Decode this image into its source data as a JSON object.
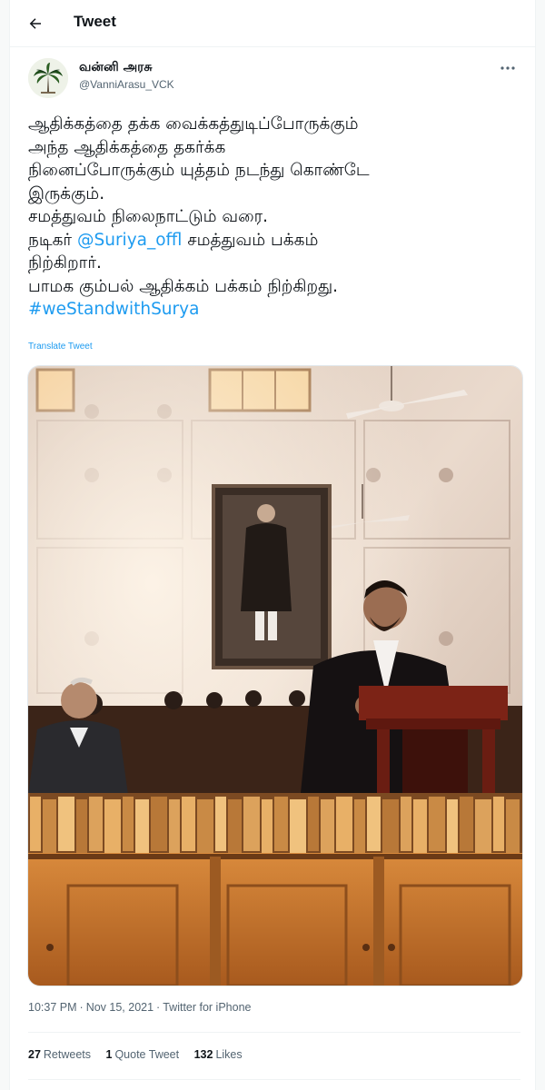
{
  "header": {
    "title": "Tweet",
    "back_icon": "arrow-left-icon"
  },
  "author": {
    "display_name": "வன்னி அரசு",
    "handle": "@VanniArasu_VCK",
    "avatar_icon": "palm-tree-avatar"
  },
  "tweet": {
    "line1": "ஆதிக்கத்தை தக்க வைக்கத்துடிப்போருக்கும்",
    "line2": "அந்த ஆதிக்கத்தை தகர்க்க",
    "line3": "நினைப்போருக்கும் யுத்தம் நடந்து கொண்டே",
    "line4": "இருக்கும்.",
    "line5": "சமத்துவம் நிலைநாட்டும் வரை.",
    "line6_pre": "நடிகர் ",
    "line6_mention": "@Suriya_offl",
    "line6_post": " சமத்துவம் பக்கம்",
    "line7": "நிற்கிறார்.",
    "line8": "பாமக கும்பல் ஆதிக்கம் பக்கம் நிற்கிறது.",
    "hashtag": "#weStandwithSurya",
    "translate_label": "Translate Tweet"
  },
  "meta": {
    "time": "10:37 PM",
    "date": "Nov 15, 2021",
    "source": "Twitter for iPhone",
    "separator": "·"
  },
  "stats": {
    "retweets_count": "27",
    "retweets_label": "Retweets",
    "quotes_count": "1",
    "quotes_label": "Quote Tweet",
    "likes_count": "132",
    "likes_label": "Likes"
  },
  "colors": {
    "accent": "#1d9bf0",
    "text": "#0f1419",
    "muted": "#536471",
    "border": "#eff3f4"
  }
}
